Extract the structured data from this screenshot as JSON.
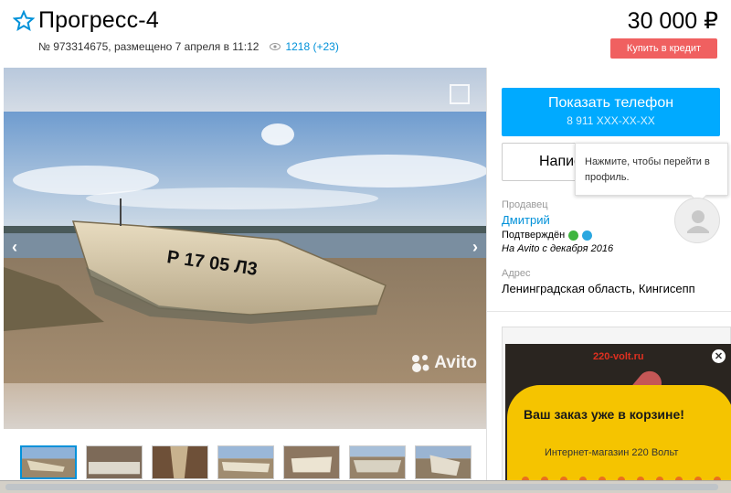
{
  "listing": {
    "title": "Прогресс-4",
    "meta": "№ 973314675, размещено 7 апреля в 11:12",
    "views": "1218 (+23)",
    "price": "30 000 ₽",
    "credit_label": "Купить в кредит"
  },
  "gallery": {
    "watermark": "Avito",
    "boat_reg": "Р 17 05 Л3",
    "thumbnails": [
      "thumb-1",
      "thumb-2",
      "thumb-3",
      "thumb-4",
      "thumb-5",
      "thumb-6",
      "thumb-7"
    ]
  },
  "contact": {
    "phone_label": "Показать телефон",
    "phone_number": "8 911 XXX-XX-XX",
    "write_label": "Напис",
    "tooltip": "Нажмите, чтобы перейти в профиль."
  },
  "seller": {
    "label": "Продавец",
    "name": "Дмитрий",
    "verified": "Подтверждён",
    "since": "На Avito с декабря 2016"
  },
  "address": {
    "label": "Адрес",
    "value": "Ленинградская область, Кингисепп"
  },
  "ad": {
    "logo": "220-volt.ru",
    "headline": "Ваш заказ уже в корзине!",
    "sub": "Интернет-магазин 220 Вольт"
  },
  "colors": {
    "accent": "#00aaff",
    "link": "#0091d9",
    "credit": "#f06060",
    "ad_yellow": "#f5c400"
  }
}
